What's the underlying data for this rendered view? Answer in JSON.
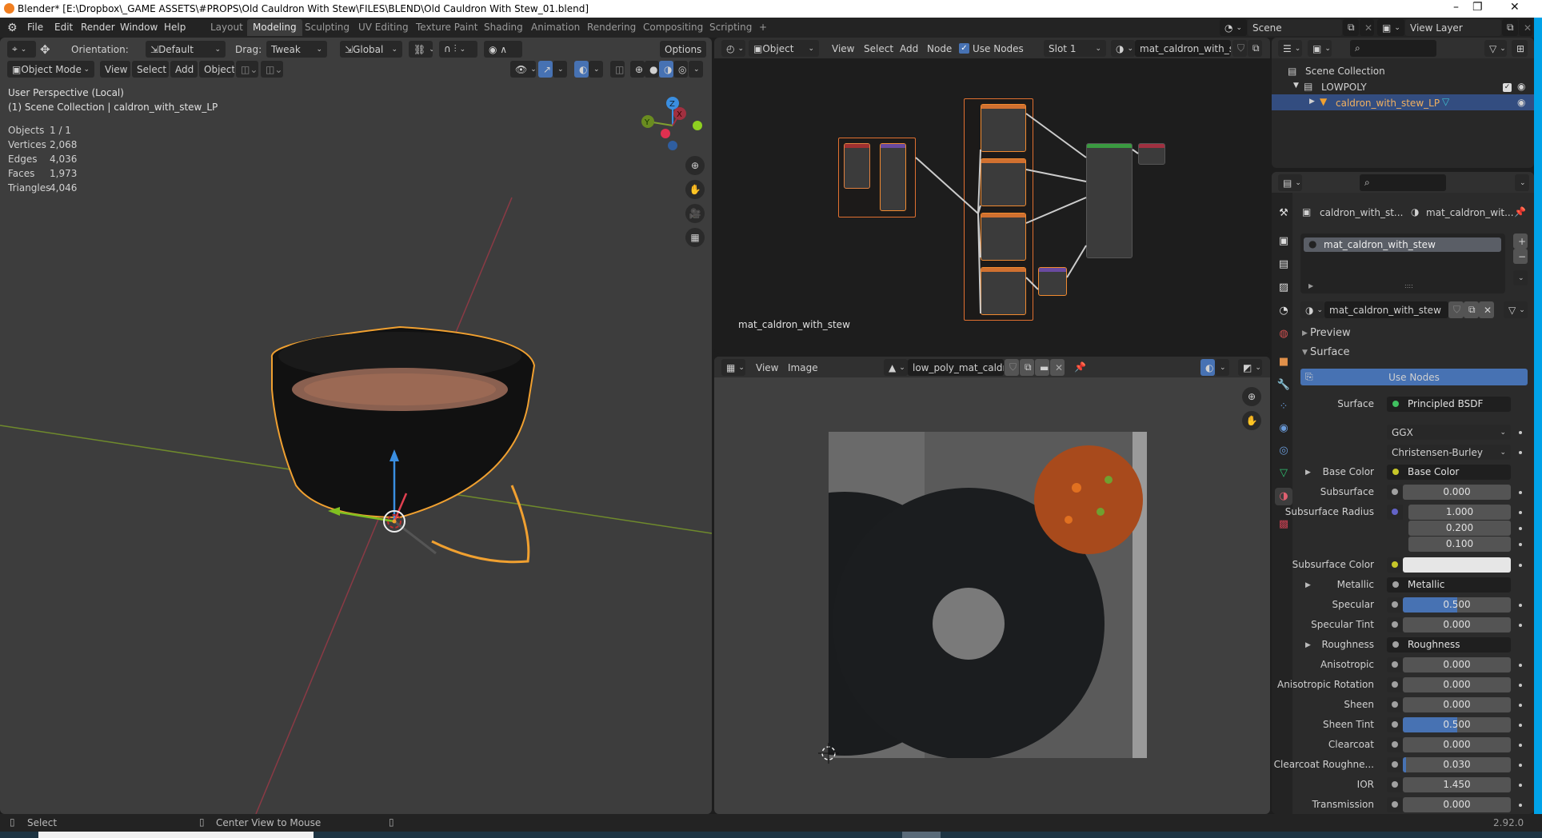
{
  "window": {
    "title": "Blender* [E:\\Dropbox\\_GAME ASSETS\\#PROPS\\Old Cauldron With Stew\\FILES\\BLEND\\Old Cauldron With Stew_01.blend]",
    "controls": {
      "minimize": "–",
      "maximize": "❐",
      "close": "✕"
    }
  },
  "menubar": {
    "menus": [
      "File",
      "Edit",
      "Render",
      "Window",
      "Help"
    ],
    "workspaces": [
      "Layout",
      "Modeling",
      "Sculpting",
      "UV Editing",
      "Texture Paint",
      "Shading",
      "Animation",
      "Rendering",
      "Compositing",
      "Scripting",
      "+"
    ],
    "active_workspace": "Modeling",
    "scene": "Scene",
    "view_layer": "View Layer"
  },
  "viewport": {
    "tool_header": {
      "orientation_label": "Orientation:",
      "orientation_value": "Default",
      "drag_label": "Drag:",
      "drag_value": "Tweak",
      "transform_orientation": "Global",
      "options": "Options"
    },
    "header": {
      "mode": "Object Mode",
      "menus": [
        "View",
        "Select",
        "Add",
        "Object"
      ]
    },
    "overlay_text": {
      "perspective": "User Perspective (Local)",
      "collection": "(1) Scene Collection | caldron_with_stew_LP"
    },
    "stats": [
      {
        "label": "Objects",
        "value": "1 / 1"
      },
      {
        "label": "Vertices",
        "value": "2,068"
      },
      {
        "label": "Edges",
        "value": "4,036"
      },
      {
        "label": "Faces",
        "value": "1,973"
      },
      {
        "label": "Triangles",
        "value": "4,046"
      }
    ],
    "gizmo_axes": {
      "z": "Z",
      "x": "X",
      "y": "Y"
    },
    "colors": {
      "x_axis": "#e04050",
      "y_axis": "#80c020",
      "z_axis": "#3a8ee0",
      "selection_outline": "#f0a030"
    }
  },
  "node_editor": {
    "header": {
      "object_type": "Object",
      "menus": [
        "View",
        "Select",
        "Add",
        "Node"
      ],
      "use_nodes_label": "Use Nodes",
      "use_nodes_checked": true,
      "slot": "Slot 1",
      "material": "mat_caldron_with_s..."
    },
    "material_label": "mat_caldron_with_stew"
  },
  "image_editor": {
    "header": {
      "menus": [
        "View",
        "Image"
      ],
      "image_name": "low_poly_mat_caldr..."
    }
  },
  "outliner": {
    "items": [
      {
        "label": "Scene Collection",
        "level": 0
      },
      {
        "label": "LOWPOLY",
        "level": 1,
        "checked": true,
        "visible": true
      },
      {
        "label": "caldron_with_stew_LP",
        "level": 2,
        "selected": true,
        "visible": true
      }
    ]
  },
  "properties": {
    "breadcrumb": {
      "object": "caldron_with_st...",
      "material": "mat_caldron_wit..."
    },
    "material_slots": [
      "mat_caldron_with_stew"
    ],
    "material_name": "mat_caldron_with_stew",
    "panels": {
      "preview": "Preview",
      "surface": "Surface"
    },
    "use_nodes_button": "Use Nodes",
    "surface_label": "Surface",
    "surface_shader": "Principled BSDF",
    "distribution": "GGX",
    "subsurface_method": "Christensen-Burley",
    "rows": [
      {
        "label": "Base Color",
        "type": "link",
        "value": "Base Color",
        "socket": "#c7c729",
        "expand": true
      },
      {
        "label": "Subsurface",
        "type": "number",
        "value": "0.000",
        "fill": 0
      },
      {
        "label": "Subsurface Radius",
        "type": "vector",
        "values": [
          "1.000",
          "0.200",
          "0.100"
        ],
        "socket": "#6363c7"
      },
      {
        "label": "Subsurface Color",
        "type": "color",
        "value": "#e6e6e6",
        "socket": "#c7c729"
      },
      {
        "label": "Metallic",
        "type": "link",
        "value": "Metallic",
        "socket": "#a1a1a1",
        "expand": true
      },
      {
        "label": "Specular",
        "type": "number",
        "value": "0.500",
        "fill": 0.5
      },
      {
        "label": "Specular Tint",
        "type": "number",
        "value": "0.000",
        "fill": 0
      },
      {
        "label": "Roughness",
        "type": "link",
        "value": "Roughness",
        "socket": "#a1a1a1",
        "expand": true
      },
      {
        "label": "Anisotropic",
        "type": "number",
        "value": "0.000",
        "fill": 0
      },
      {
        "label": "Anisotropic Rotation",
        "type": "number",
        "value": "0.000",
        "fill": 0
      },
      {
        "label": "Sheen",
        "type": "number",
        "value": "0.000",
        "fill": 0
      },
      {
        "label": "Sheen Tint",
        "type": "number",
        "value": "0.500",
        "fill": 0.5
      },
      {
        "label": "Clearcoat",
        "type": "number",
        "value": "0.000",
        "fill": 0
      },
      {
        "label": "Clearcoat Roughne...",
        "type": "number",
        "value": "0.030",
        "fill": 0.03
      },
      {
        "label": "IOR",
        "type": "number",
        "value": "1.450",
        "fill": 0
      },
      {
        "label": "Transmission",
        "type": "number",
        "value": "0.000",
        "fill": 0
      }
    ]
  },
  "statusbar": {
    "left_action": "Select",
    "middle_action": "Center View to Mouse",
    "version": "2.92.0"
  }
}
